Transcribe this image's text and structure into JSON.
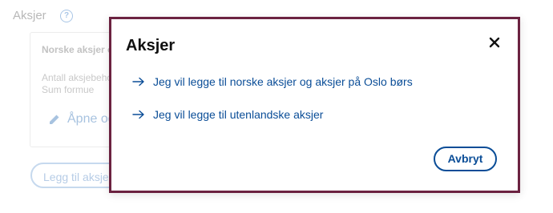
{
  "background": {
    "section_title": "Aksjer",
    "help_icon": "?",
    "card": {
      "title": "Norske aksjer o",
      "line1": "Antall aksjebeho",
      "line2": "Sum formue",
      "open_label": "Åpne og"
    },
    "add_button": "Legg til aksjer"
  },
  "modal": {
    "title": "Aksjer",
    "options": [
      {
        "label": "Jeg vil legge til norske aksjer og aksjer på Oslo børs",
        "icon": "arrow-right-icon"
      },
      {
        "label": "Jeg vil legge til utenlandske aksjer",
        "icon": "arrow-right-icon"
      }
    ],
    "cancel_label": "Avbryt"
  },
  "colors": {
    "modal_border": "#6b2240",
    "link": "#0a4d97"
  }
}
